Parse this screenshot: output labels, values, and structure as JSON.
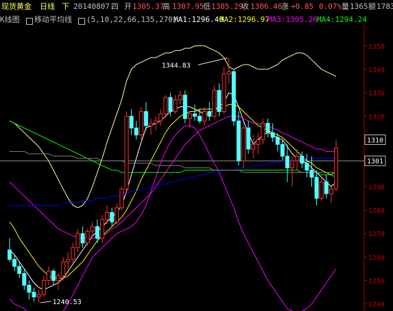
{
  "header": {
    "title": "现货黄金",
    "period": "日线",
    "nav": "下",
    "date": "20140807",
    "weekday": "四",
    "open_label": "开",
    "open_value": "1305.37",
    "high_label": "高",
    "high_value": "1307.95",
    "low_label": "低",
    "low_value": "1305.29",
    "close_label": "收",
    "close_value": "1306.46",
    "change_label": "涨",
    "change_value": "+0.85",
    "change_pct": "0.07%",
    "volume_label": "量",
    "volume_value": "1365",
    "amount_label": "额",
    "amount_value": "1783"
  },
  "indicator_bar": {
    "kline_label": "K线图",
    "ma_label": "移动平均线",
    "ma_params": "(5,10,22,66,135,270)",
    "ma1": "MA1:1296.40",
    "ma2": "MA2:1296.97",
    "ma3": "MA3:1305.26",
    "ma4": "MA4:1294.24"
  },
  "colors": {
    "background": "#000000",
    "up": "#ff3232",
    "down": "#54ffff",
    "text": "#c0c0c0",
    "ma1": "#ffffff",
    "ma2": "#ffff00",
    "ma3": "#ff00ff",
    "ma4": "#00ff00",
    "ma5": "#0000ff",
    "ma6": "#808080",
    "axis": "#c00000",
    "boll": "#ffffb0"
  },
  "chart_data": {
    "type": "candlestick",
    "ylim": [
      1237,
      1359
    ],
    "yticks": [
      1240,
      1250,
      1260,
      1270,
      1280,
      1290,
      1300,
      1310,
      1320,
      1330,
      1340,
      1350
    ],
    "current_price": "1301",
    "highlight_price": "1310",
    "annotations": [
      {
        "text": "1344.83",
        "price": 1344.83
      },
      {
        "text": "1240.53",
        "price": 1240.53
      }
    ],
    "candles": [
      [
        1263,
        1268,
        1258,
        1259
      ],
      [
        1259,
        1261,
        1254,
        1256
      ],
      [
        1256,
        1258,
        1251,
        1253
      ],
      [
        1253,
        1255,
        1246,
        1248
      ],
      [
        1248,
        1250,
        1242,
        1245
      ],
      [
        1245,
        1247,
        1241,
        1243
      ],
      [
        1243,
        1246,
        1240.53,
        1244
      ],
      [
        1244,
        1252,
        1243,
        1250
      ],
      [
        1250,
        1256,
        1248,
        1254
      ],
      [
        1254,
        1255,
        1248,
        1250
      ],
      [
        1250,
        1253,
        1246,
        1252
      ],
      [
        1252,
        1260,
        1250,
        1258
      ],
      [
        1258,
        1262,
        1255,
        1259
      ],
      [
        1259,
        1266,
        1257,
        1264
      ],
      [
        1264,
        1272,
        1262,
        1270
      ],
      [
        1270,
        1273,
        1264,
        1266
      ],
      [
        1266,
        1272,
        1265,
        1271
      ],
      [
        1271,
        1275,
        1269,
        1273
      ],
      [
        1273,
        1276,
        1266,
        1268
      ],
      [
        1268,
        1278,
        1266,
        1276
      ],
      [
        1276,
        1282,
        1274,
        1279
      ],
      [
        1279,
        1281,
        1273,
        1275
      ],
      [
        1275,
        1283,
        1274,
        1281
      ],
      [
        1281,
        1290,
        1280,
        1289
      ],
      [
        1289,
        1322,
        1288,
        1320
      ],
      [
        1320,
        1323,
        1312,
        1315
      ],
      [
        1315,
        1318,
        1310,
        1312
      ],
      [
        1312,
        1324,
        1310,
        1322
      ],
      [
        1322,
        1326,
        1314,
        1316
      ],
      [
        1316,
        1319,
        1312,
        1317
      ],
      [
        1317,
        1320,
        1314,
        1318
      ],
      [
        1318,
        1323,
        1316,
        1321
      ],
      [
        1321,
        1329,
        1320,
        1328
      ],
      [
        1328,
        1330,
        1320,
        1322
      ],
      [
        1322,
        1329,
        1321,
        1327
      ],
      [
        1327,
        1331,
        1325,
        1329
      ],
      [
        1329,
        1331,
        1317,
        1319
      ],
      [
        1319,
        1322,
        1315,
        1321
      ],
      [
        1321,
        1325,
        1318,
        1320
      ],
      [
        1320,
        1323,
        1317,
        1318
      ],
      [
        1318,
        1324,
        1316,
        1322
      ],
      [
        1322,
        1326,
        1318,
        1320
      ],
      [
        1320,
        1333,
        1319,
        1331
      ],
      [
        1331,
        1334,
        1320,
        1322
      ],
      [
        1322,
        1341,
        1321,
        1338
      ],
      [
        1338,
        1344.83,
        1334,
        1339
      ],
      [
        1339,
        1340,
        1316,
        1318
      ],
      [
        1318,
        1322,
        1299,
        1301
      ],
      [
        1301,
        1317,
        1298,
        1315
      ],
      [
        1315,
        1318,
        1304,
        1306
      ],
      [
        1306,
        1312,
        1302,
        1308
      ],
      [
        1308,
        1313,
        1304,
        1310
      ],
      [
        1310,
        1319,
        1308,
        1317
      ],
      [
        1317,
        1319,
        1311,
        1313
      ],
      [
        1313,
        1317,
        1309,
        1311
      ],
      [
        1311,
        1313,
        1305,
        1308
      ],
      [
        1308,
        1310,
        1301,
        1303
      ],
      [
        1303,
        1308,
        1292,
        1298
      ],
      [
        1298,
        1303,
        1290,
        1301
      ],
      [
        1301,
        1306,
        1297,
        1303
      ],
      [
        1303,
        1305,
        1298,
        1300
      ],
      [
        1300,
        1304,
        1294,
        1297
      ],
      [
        1297,
        1303,
        1290,
        1294
      ],
      [
        1294,
        1297,
        1282,
        1285
      ],
      [
        1285,
        1294,
        1284,
        1292
      ],
      [
        1292,
        1295,
        1285,
        1287
      ],
      [
        1287,
        1291,
        1283,
        1289
      ],
      [
        1289,
        1310,
        1288,
        1306.46
      ]
    ],
    "ma_series": [
      {
        "name": "MA1",
        "color": "#ffffff",
        "values": [
          1263,
          1261,
          1258,
          1255,
          1252,
          1249,
          1247,
          1246,
          1247,
          1248,
          1249,
          1251,
          1254,
          1257,
          1260,
          1263,
          1266,
          1269,
          1271,
          1273,
          1275,
          1277,
          1279,
          1282,
          1288,
          1295,
          1302,
          1309,
          1315,
          1316,
          1317,
          1318,
          1320,
          1322,
          1323,
          1324,
          1324,
          1324,
          1323,
          1322,
          1321,
          1321,
          1323,
          1324,
          1326,
          1330,
          1329,
          1324,
          1318,
          1313,
          1308,
          1310,
          1312,
          1313,
          1312,
          1311,
          1310,
          1307,
          1304,
          1302,
          1301,
          1300,
          1298,
          1296,
          1294,
          1292,
          1290,
          1292
        ]
      },
      {
        "name": "MA2",
        "color": "#ffff00",
        "values": [
          1275,
          1272,
          1268,
          1265,
          1262,
          1259,
          1256,
          1254,
          1252,
          1251,
          1251,
          1251,
          1252,
          1254,
          1256,
          1258,
          1261,
          1264,
          1267,
          1269,
          1271,
          1273,
          1275,
          1277,
          1280,
          1284,
          1288,
          1293,
          1297,
          1301,
          1305,
          1309,
          1313,
          1316,
          1318,
          1320,
          1321,
          1322,
          1322,
          1323,
          1323,
          1323,
          1323,
          1323,
          1324,
          1325,
          1325,
          1324,
          1322,
          1320,
          1318,
          1316,
          1315,
          1314,
          1313,
          1312,
          1311,
          1309,
          1307,
          1305,
          1303,
          1301,
          1300,
          1298,
          1297,
          1296,
          1295,
          1297
        ]
      },
      {
        "name": "MA3",
        "color": "#ff00ff",
        "values": [
          1292,
          1290,
          1288,
          1286,
          1284,
          1282,
          1280,
          1278,
          1276,
          1274,
          1272,
          1271,
          1270,
          1269,
          1268,
          1268,
          1268,
          1268,
          1268,
          1269,
          1270,
          1272,
          1273,
          1275,
          1277,
          1279,
          1281,
          1283,
          1285,
          1287,
          1290,
          1293,
          1296,
          1299,
          1302,
          1305,
          1308,
          1310,
          1312,
          1314,
          1315,
          1316,
          1317,
          1318,
          1319,
          1320,
          1320,
          1320,
          1319,
          1318,
          1317,
          1317,
          1316,
          1316,
          1315,
          1314,
          1313,
          1312,
          1311,
          1310,
          1309,
          1308,
          1307,
          1306,
          1306,
          1305,
          1305,
          1305
        ]
      },
      {
        "name": "MA4",
        "color": "#00ff00",
        "values": [
          1318,
          1317,
          1316,
          1315,
          1314,
          1313,
          1312,
          1311,
          1310,
          1309,
          1308,
          1307,
          1306,
          1305,
          1304,
          1303,
          1302,
          1301,
          1300,
          1299,
          1298,
          1297,
          1297,
          1296,
          1296,
          1296,
          1296,
          1296,
          1296,
          1296,
          1296,
          1296,
          1296,
          1296,
          1296,
          1296,
          1297,
          1297,
          1297,
          1297,
          1297,
          1297,
          1297,
          1297,
          1297,
          1297,
          1297,
          1297,
          1297,
          1297,
          1297,
          1297,
          1297,
          1297,
          1297,
          1297,
          1297,
          1297,
          1297,
          1297,
          1296,
          1296,
          1296,
          1296,
          1295,
          1295,
          1295,
          1294
        ]
      },
      {
        "name": "MA5",
        "color": "#0000ff",
        "values": [
          1282,
          1282,
          1282,
          1282,
          1282,
          1282,
          1282,
          1282,
          1282,
          1282,
          1282,
          1283,
          1283,
          1283,
          1283,
          1284,
          1284,
          1284,
          1285,
          1285,
          1285,
          1286,
          1286,
          1287,
          1287,
          1288,
          1288,
          1289,
          1289,
          1290,
          1290,
          1291,
          1291,
          1292,
          1292,
          1293,
          1293,
          1294,
          1294,
          1295,
          1295,
          1296,
          1296,
          1296,
          1297,
          1297,
          1297,
          1298,
          1298,
          1298,
          1299,
          1299,
          1299,
          1300,
          1300,
          1300,
          1301,
          1301,
          1301,
          1301,
          1302,
          1302,
          1302,
          1302,
          1302,
          1302,
          1302,
          1302
        ]
      },
      {
        "name": "MA6",
        "color": "#808080",
        "values": [
          1305,
          1305,
          1305,
          1305,
          1304,
          1304,
          1304,
          1304,
          1304,
          1303,
          1303,
          1303,
          1303,
          1303,
          1302,
          1302,
          1302,
          1302,
          1302,
          1301,
          1301,
          1301,
          1301,
          1301,
          1300,
          1300,
          1300,
          1300,
          1300,
          1300,
          1299,
          1299,
          1299,
          1299,
          1299,
          1299,
          1298,
          1298,
          1298,
          1298,
          1298,
          1298,
          1297,
          1297,
          1297,
          1297,
          1297,
          1297,
          1296,
          1296,
          1296,
          1296,
          1296,
          1296,
          1296,
          1296,
          1296,
          1296,
          1296,
          1296,
          1296,
          1296,
          1296,
          1296,
          1296,
          1296,
          1296,
          1296
        ]
      }
    ],
    "boll_upper": [
      1318,
      1317,
      1315,
      1313,
      1311,
      1309,
      1307,
      1304,
      1301,
      1297,
      1293,
      1289,
      1285,
      1282,
      1281,
      1282,
      1285,
      1290,
      1296,
      1302,
      1309,
      1315,
      1321,
      1327,
      1335,
      1340,
      1342,
      1343,
      1344,
      1345,
      1345,
      1346,
      1347,
      1347,
      1348,
      1348,
      1349,
      1349,
      1350,
      1350,
      1350,
      1349,
      1348,
      1347,
      1345,
      1341,
      1340,
      1341,
      1342,
      1342,
      1341,
      1340,
      1340,
      1340,
      1341,
      1342,
      1344,
      1345,
      1346,
      1347,
      1347,
      1346,
      1344,
      1342,
      1340,
      1339,
      1338,
      1337
    ],
    "boll_lower": [
      1242,
      1240,
      1239,
      1238,
      1236,
      1235,
      1234,
      1233,
      1233,
      1234,
      1235,
      1237,
      1240,
      1244,
      1248,
      1252,
      1256,
      1260,
      1262,
      1264,
      1266,
      1268,
      1270,
      1271,
      1272,
      1273,
      1275,
      1278,
      1282,
      1288,
      1294,
      1300,
      1305,
      1309,
      1312,
      1314,
      1316,
      1316,
      1315,
      1312,
      1308,
      1304,
      1300,
      1296,
      1291,
      1286,
      1281,
      1275,
      1270,
      1266,
      1262,
      1258,
      1254,
      1250,
      1247,
      1244,
      1241,
      1238,
      1237,
      1236,
      1237,
      1238,
      1240,
      1243,
      1246,
      1249,
      1252,
      1255
    ]
  }
}
